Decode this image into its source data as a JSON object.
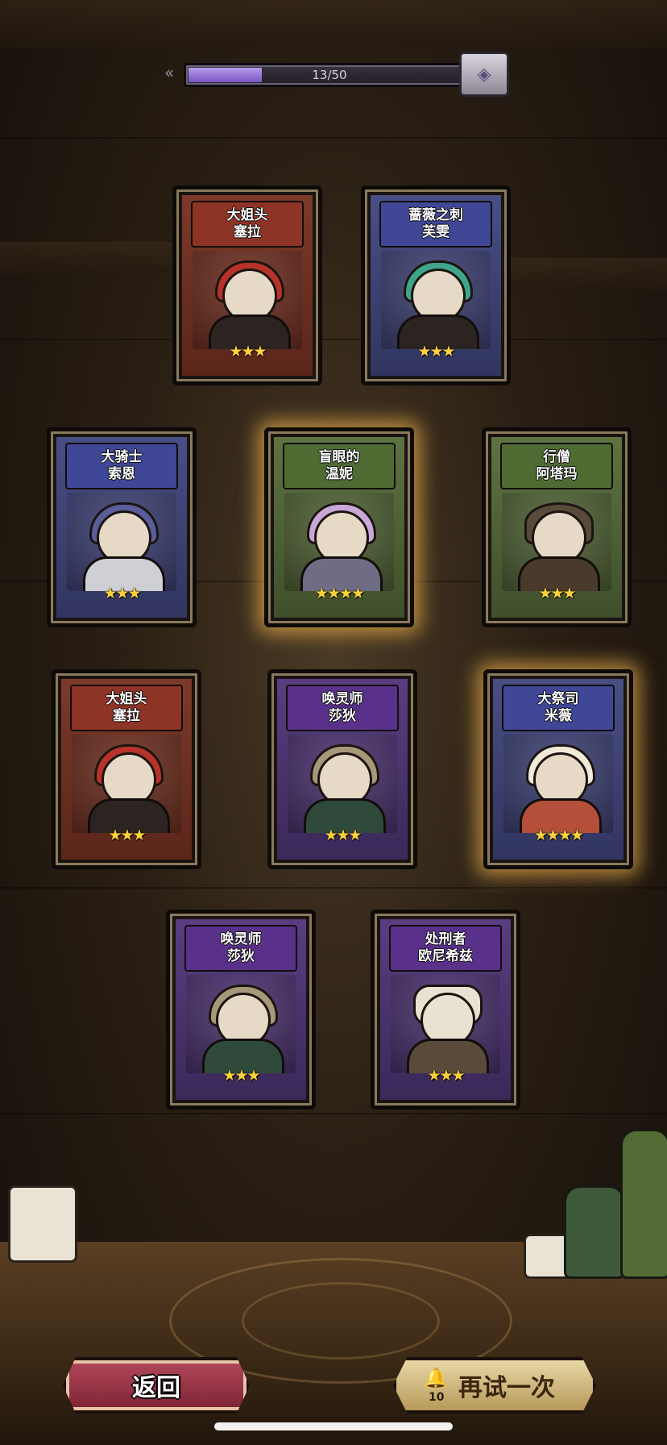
{
  "progress": {
    "text": "13/50",
    "fraction": 0.26
  },
  "cards": [
    {
      "title": "大姐头",
      "name": "塞拉",
      "stars": 3,
      "rarity": "red"
    },
    {
      "title": "蔷薇之刺",
      "name": "芙雯",
      "stars": 3,
      "rarity": "blue"
    },
    {
      "title": "大骑士",
      "name": "索恩",
      "stars": 3,
      "rarity": "blue"
    },
    {
      "title": "盲眼的",
      "name": "温妮",
      "stars": 4,
      "rarity": "green"
    },
    {
      "title": "行僧",
      "name": "阿塔玛",
      "stars": 3,
      "rarity": "green"
    },
    {
      "title": "大姐头",
      "name": "塞拉",
      "stars": 3,
      "rarity": "red"
    },
    {
      "title": "唤灵师",
      "name": "莎狄",
      "stars": 3,
      "rarity": "purple"
    },
    {
      "title": "大祭司",
      "name": "米薇",
      "stars": 4,
      "rarity": "blue"
    },
    {
      "title": "唤灵师",
      "name": "莎狄",
      "stars": 3,
      "rarity": "purple"
    },
    {
      "title": "处刑者",
      "name": "欧尼希兹",
      "stars": 3,
      "rarity": "purple"
    }
  ],
  "buttons": {
    "back": "返回",
    "retry": "再试一次",
    "retry_cost": "10"
  },
  "icons": {
    "chest": "treasure-chest-icon",
    "bell": "bell-icon"
  },
  "colors": {
    "progress_fill": "#9a7ad8",
    "star": "#ffd23c",
    "back_button": "#a43a4c",
    "retry_button": "#d9c38a"
  }
}
